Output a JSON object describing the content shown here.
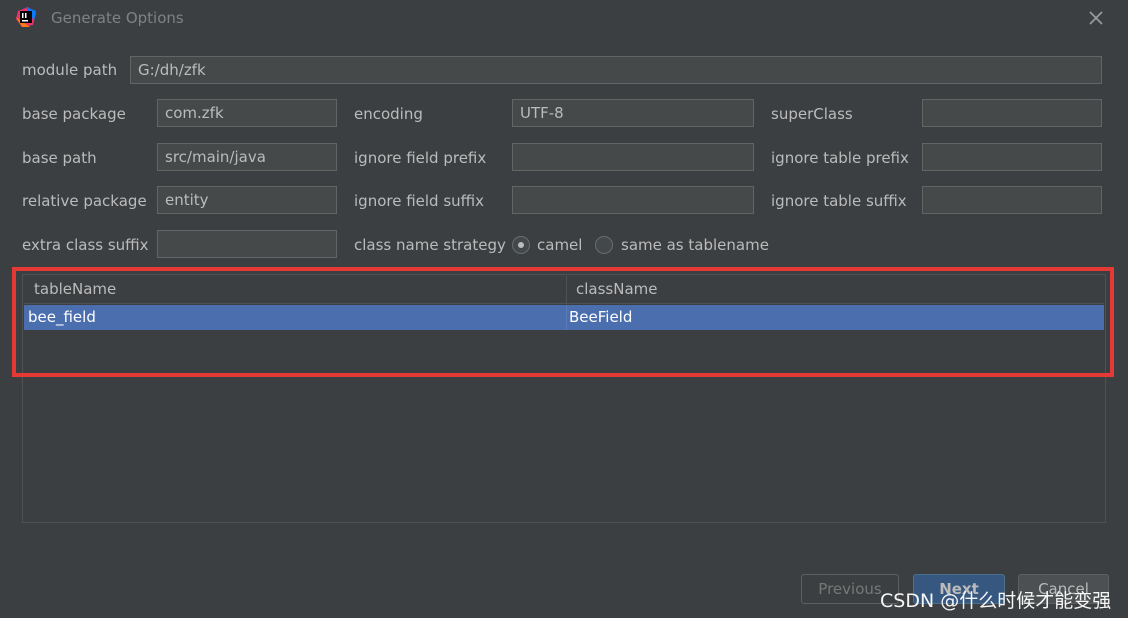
{
  "window": {
    "title": "Generate Options",
    "app_icon": "intellij-icon",
    "close_icon": "close-icon"
  },
  "form": {
    "module_path": {
      "label": "module path",
      "value": "G:/dh/zfk"
    },
    "base_package": {
      "label": "base package",
      "value": "com.zfk"
    },
    "encoding": {
      "label": "encoding",
      "value": "UTF-8"
    },
    "super_class": {
      "label": "superClass",
      "value": ""
    },
    "base_path": {
      "label": "base path",
      "value": "src/main/java"
    },
    "ignore_field_prefix": {
      "label": "ignore field prefix",
      "value": ""
    },
    "ignore_table_prefix": {
      "label": "ignore table prefix",
      "value": ""
    },
    "relative_package": {
      "label": "relative package",
      "value": "entity"
    },
    "ignore_field_suffix": {
      "label": "ignore field suffix",
      "value": ""
    },
    "ignore_table_suffix": {
      "label": "ignore table suffix",
      "value": ""
    },
    "extra_class_suffix": {
      "label": "extra class suffix",
      "value": ""
    },
    "class_name_strategy": {
      "label": "class name strategy",
      "options": [
        "camel",
        "same as tablename"
      ],
      "selected": "camel"
    }
  },
  "table": {
    "columns": [
      "tableName",
      "className"
    ],
    "rows": [
      {
        "tableName": "bee_field",
        "className": "BeeField",
        "selected": true
      }
    ]
  },
  "buttons": {
    "previous": "Previous",
    "next": "Next",
    "cancel": "Cancel"
  },
  "watermark": "CSDN @什么时候才能变强",
  "colors": {
    "background": "#3c3f41",
    "selection": "#4b6eaf",
    "highlight_box": "#e53935"
  }
}
